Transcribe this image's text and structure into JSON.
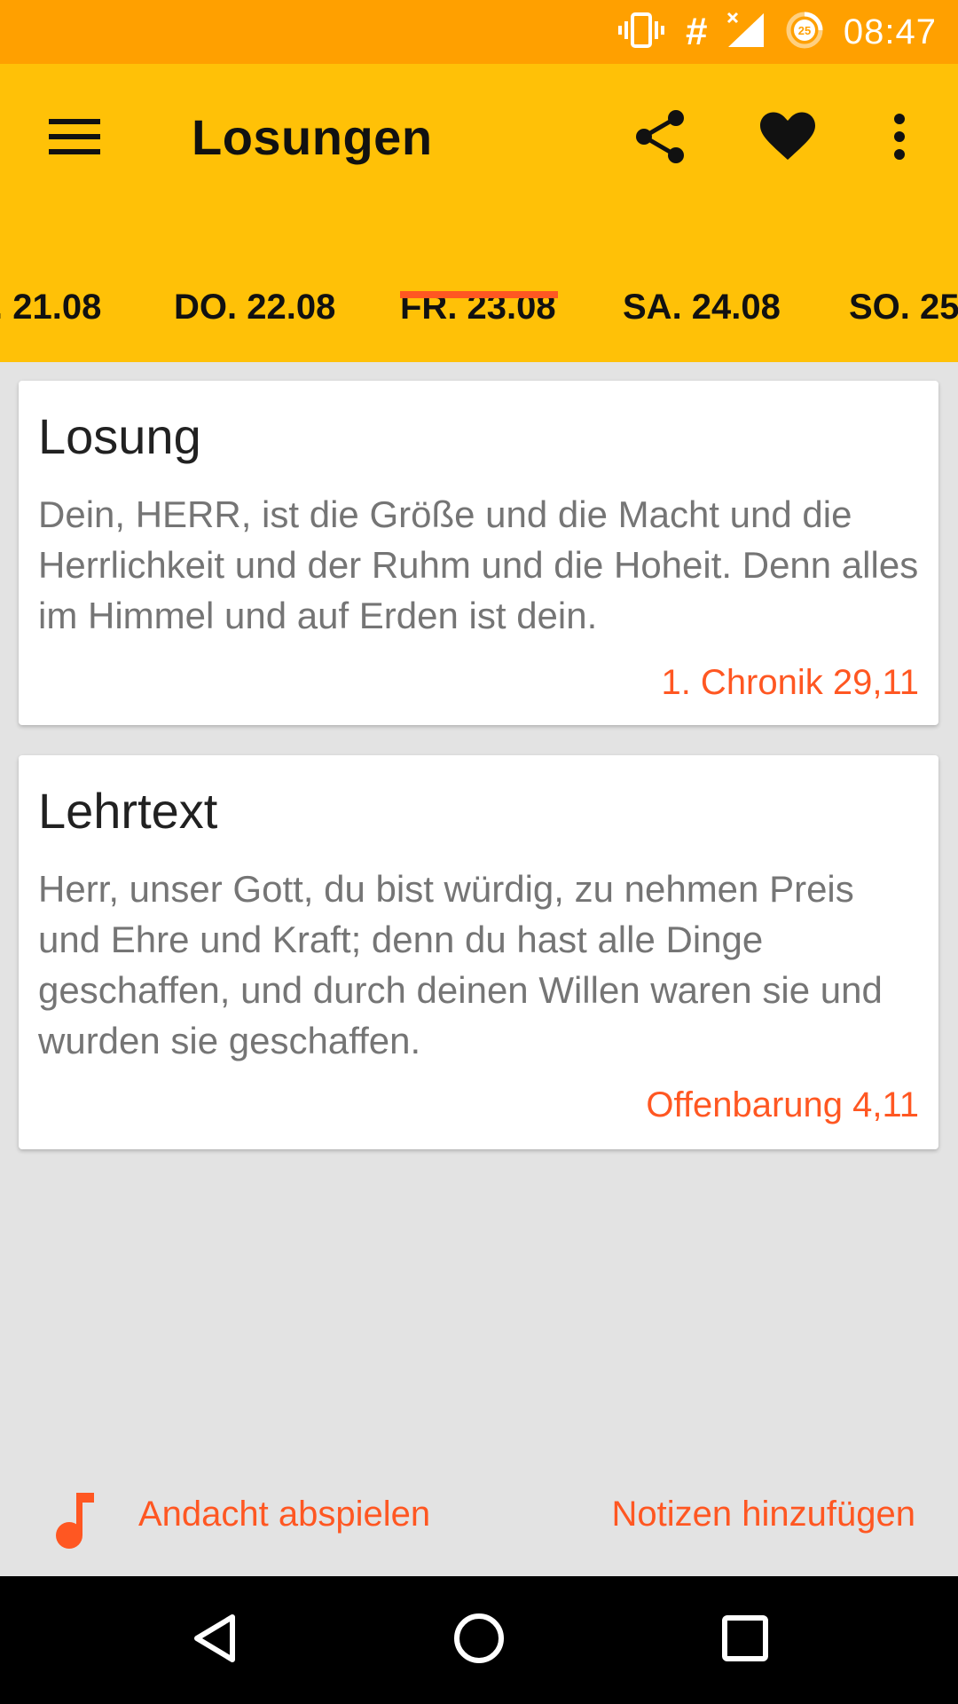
{
  "status_bar": {
    "time": "08:47",
    "battery_level": "25",
    "icons": [
      "vibrate-icon",
      "hash-icon",
      "signal-icon",
      "battery-icon"
    ]
  },
  "app_bar": {
    "title": "Losungen",
    "actions": [
      "menu-icon",
      "share-icon",
      "heart-icon",
      "more-vert-icon"
    ]
  },
  "tabs": [
    {
      "label": ". 21.08",
      "selected": false
    },
    {
      "label": "DO. 22.08",
      "selected": false
    },
    {
      "label": "FR. 23.08",
      "selected": true
    },
    {
      "label": "SA. 24.08",
      "selected": false
    },
    {
      "label": "SO. 25",
      "selected": false
    }
  ],
  "cards": [
    {
      "title": "Losung",
      "text": "Dein, HERR, ist die Größe und die Macht und die Herrlichkeit und der Ruhm und die Hoheit. Denn alles im Himmel und auf Erden ist dein.",
      "reference": "1. Chronik 29,11"
    },
    {
      "title": "Lehrtext",
      "text": "Herr, unser Gott, du bist würdig, zu nehmen Preis und Ehre und Kraft; denn du hast alle Dinge geschaffen, und durch deinen Willen waren sie und wurden sie geschaffen.",
      "reference": "Offenbarung 4,11"
    }
  ],
  "bottom_actions": {
    "play_label": "Andacht abspielen",
    "notes_label": "Notizen hinzufügen"
  },
  "colors": {
    "status_bar": "#FFA000",
    "app_bar": "#FFC107",
    "accent": "#FF5722",
    "background": "#E3E3E3"
  }
}
